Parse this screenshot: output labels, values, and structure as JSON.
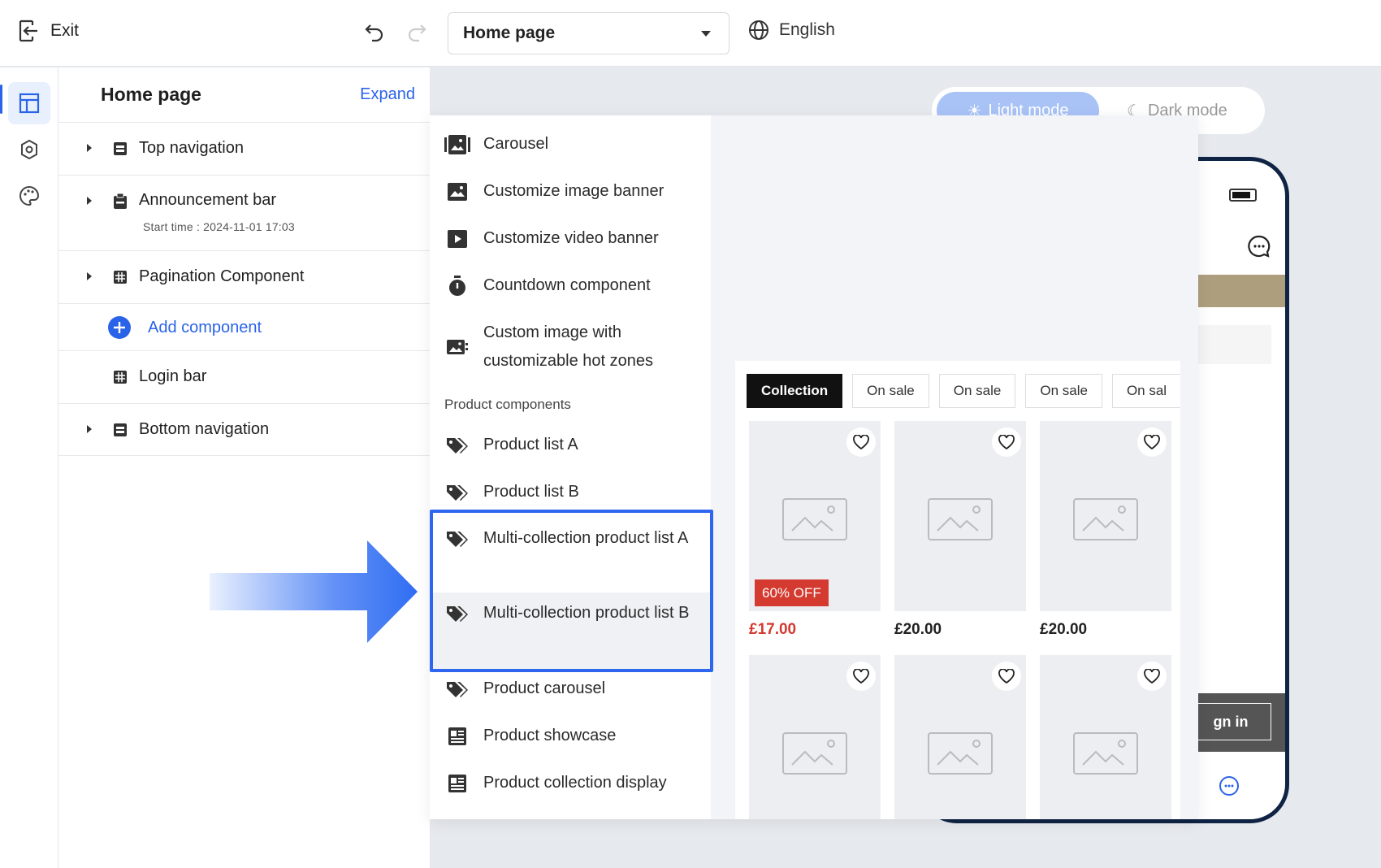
{
  "topbar": {
    "exit_label": "Exit",
    "page_select": "Home page",
    "language": "English"
  },
  "tree": {
    "title": "Home page",
    "expand_label": "Expand",
    "items": [
      {
        "label": "Top navigation"
      },
      {
        "label": "Announcement bar",
        "sub": "Start time : 2024-11-01 17:03"
      },
      {
        "label": "Pagination Component"
      },
      {
        "label": "Login bar"
      },
      {
        "label": "Bottom navigation"
      }
    ],
    "add_component_label": "Add component"
  },
  "canvas": {
    "light_mode": "Light mode",
    "dark_mode": "Dark mode",
    "signin_label": "gn in"
  },
  "library": {
    "items": [
      {
        "label": "Carousel",
        "icon": "carousel-icon"
      },
      {
        "label": "Customize image banner",
        "icon": "image-icon"
      },
      {
        "label": "Customize video banner",
        "icon": "video-icon"
      },
      {
        "label": "Countdown component",
        "icon": "timer-icon"
      },
      {
        "label": "Custom image with customizable hot zones",
        "icon": "hotzone-image-icon"
      }
    ],
    "section_product": "Product components",
    "product_items": [
      {
        "label": "Product list A",
        "icon": "tag-icon"
      },
      {
        "label": "Product list B",
        "icon": "tag-icon"
      },
      {
        "label": "Multi-collection product list A",
        "icon": "tag-icon"
      },
      {
        "label": "Multi-collection product list B",
        "icon": "tag-icon"
      },
      {
        "label": "Product carousel",
        "icon": "tag-icon"
      },
      {
        "label": "Product showcase",
        "icon": "showcase-icon"
      },
      {
        "label": "Product collection display",
        "icon": "showcase-icon"
      }
    ]
  },
  "preview": {
    "tabs": [
      "Collection",
      "On sale",
      "On sale",
      "On sale",
      "On sal"
    ],
    "badge": "60% OFF",
    "prices": [
      "£17.00",
      "£20.00",
      "£20.00"
    ]
  },
  "colors": {
    "accent": "#2b63e8",
    "highlight_border": "#2f66f0",
    "sale_red": "#d43a2f",
    "promo_bar": "#ad9f7e",
    "phone_frame": "#0f2344"
  }
}
